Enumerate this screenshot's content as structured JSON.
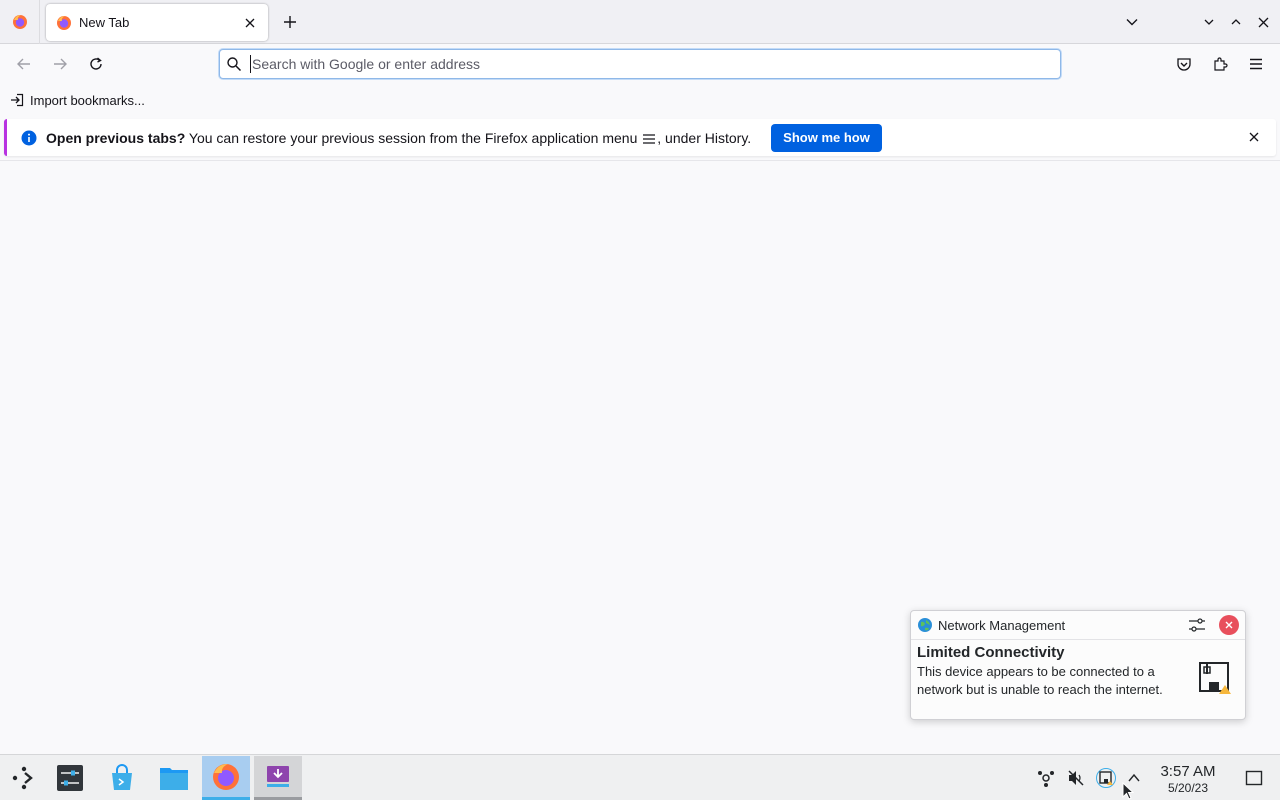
{
  "browser": {
    "tab": {
      "title": "New Tab"
    },
    "urlbar": {
      "placeholder": "Search with Google or enter address"
    },
    "bookmarks": {
      "import_label": "Import bookmarks..."
    },
    "notification": {
      "title": "Open previous tabs?",
      "message_before_icon": " You can restore your previous session from the Firefox application menu ",
      "message_after_icon": ", under History.",
      "button_label": "Show me how"
    }
  },
  "toast": {
    "app_name": "Network Management",
    "title": "Limited Connectivity",
    "body": "This device appears to be connected to a network but is unable to reach the internet."
  },
  "taskbar": {
    "time": "3:57 AM",
    "date": "5/20/23"
  },
  "colors": {
    "accent_blue": "#0061e0",
    "notification_stripe": "#b833e1",
    "taskbar_active": "#3daee9",
    "toast_close": "#e84f5c"
  }
}
